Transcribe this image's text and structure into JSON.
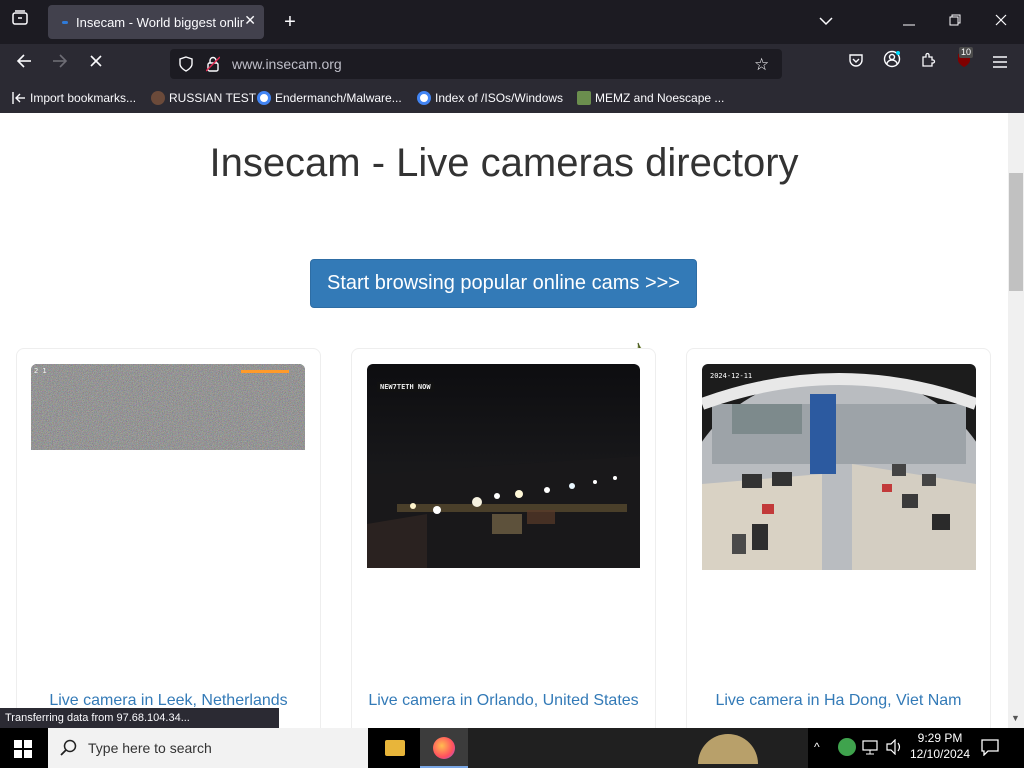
{
  "browser": {
    "tab": {
      "title": "Insecam - World biggest online"
    },
    "url": "www.insecam.org",
    "addon_badge": "10",
    "bookmarks": [
      {
        "label": "Import bookmarks...",
        "icon": "import-icon",
        "color": "#fbfbfe"
      },
      {
        "label": "RUSSIAN TEST",
        "icon": "favicon",
        "color": "#6b4a3a"
      },
      {
        "label": "Endermanch/Malware...",
        "icon": "google-icon",
        "color": "#4285f4"
      },
      {
        "label": "Index of /ISOs/Windows",
        "icon": "google-icon",
        "color": "#4285f4"
      },
      {
        "label": "MEMZ and Noescape ...",
        "icon": "image-icon",
        "color": "#6b8e4e"
      }
    ],
    "status_text": "Transferring data from 97.68.104.34..."
  },
  "page": {
    "heading": "Insecam - Live cameras directory",
    "browse_button": "Start browsing popular online cams >>>",
    "cameras": [
      {
        "caption": "Live camera in Leek, Netherlands",
        "overlay": "2 1",
        "style": "noise"
      },
      {
        "caption": "Live camera in Orlando, United States",
        "overlay": "NEW7TETH NOW",
        "style": "night"
      },
      {
        "caption": "Live camera in Ha Dong, Viet Nam",
        "overlay": "2024-12-11",
        "style": "office"
      }
    ]
  },
  "taskbar": {
    "search_placeholder": "Type here to search",
    "time": "9:29 PM",
    "date": "12/10/2024"
  },
  "colors": {
    "link": "#337ab7",
    "button": "#337ab7",
    "tab_active": "#42414d"
  }
}
